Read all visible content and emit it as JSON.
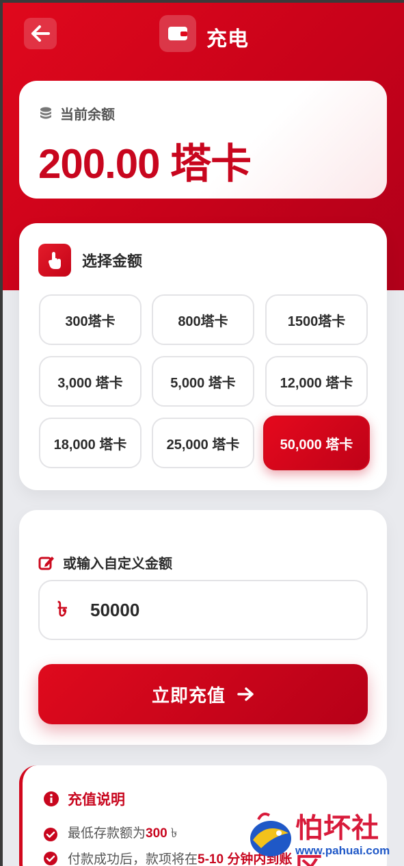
{
  "header": {
    "title": "充电",
    "back_icon": "arrow-left-icon",
    "wallet_icon": "wallet-icon"
  },
  "balance": {
    "label": "当前余额",
    "value": "200.00 塔卡",
    "icon": "coins-icon"
  },
  "amounts": {
    "title": "选择金额",
    "icon": "hand-pointer-icon",
    "options": [
      "300塔卡",
      "800塔卡",
      "1500塔卡",
      "3,000 塔卡",
      "5,000 塔卡",
      "12,000 塔卡",
      "18,000 塔卡",
      "25,000 塔卡",
      "50,000 塔卡"
    ],
    "selected": "50,000 塔卡"
  },
  "custom": {
    "title": "或输入自定义金额",
    "icon": "edit-icon",
    "currency_symbol": "৳",
    "value": "50000"
  },
  "submit": {
    "label": "立即充值"
  },
  "info": {
    "title": "充值说明",
    "items": [
      {
        "prefix": "最低存款额为",
        "strong": "300",
        "suffix": " ৳"
      },
      {
        "prefix": "付款成功后，款项将在",
        "strong": "5-10 分钟内到账",
        "suffix": ""
      }
    ]
  },
  "watermark": {
    "title": "怕坏社区",
    "url": "www.pahuai.com"
  },
  "colors": {
    "brand_red": "#c8061e",
    "page_bg": "#e9eaee"
  }
}
